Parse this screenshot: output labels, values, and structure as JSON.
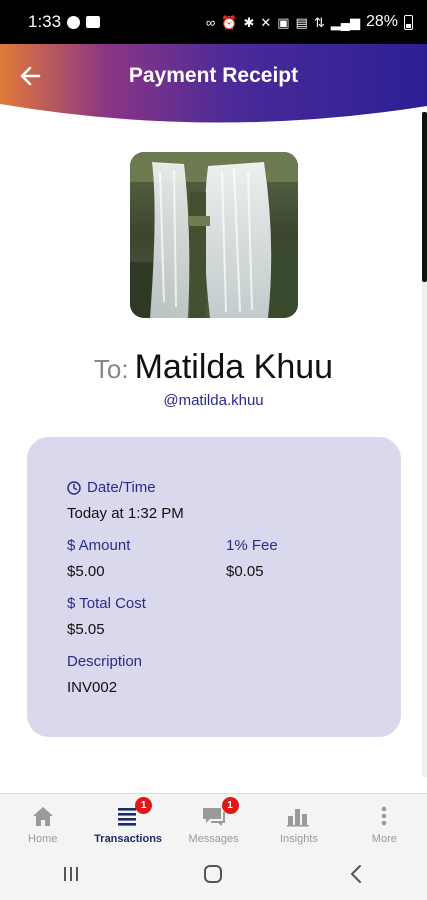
{
  "status_bar": {
    "time": "1:33",
    "battery": "28%"
  },
  "header": {
    "title": "Payment Receipt",
    "back_icon": "arrow-left-icon",
    "colors": {
      "start": "#e07a3a",
      "mid": "#7a2f8f",
      "end": "#2c1f96"
    }
  },
  "recipient": {
    "to_prefix": "To:",
    "name": "Matilda Khuu",
    "handle": "@matilda.khuu"
  },
  "details": {
    "datetime_label": "Date/Time",
    "datetime_value": "Today at 1:32 PM",
    "amount_label": "$ Amount",
    "amount_value": "$5.00",
    "fee_label": "1% Fee",
    "fee_value": "$0.05",
    "total_label": "$ Total Cost",
    "total_value": "$5.05",
    "description_label": "Description",
    "description_value": "INV002"
  },
  "bottom_nav": {
    "items": [
      {
        "label": "Home",
        "icon": "home-icon"
      },
      {
        "label": "Transactions",
        "icon": "list-icon",
        "badge": "1",
        "active": true
      },
      {
        "label": "Messages",
        "icon": "chat-icon",
        "badge": "1"
      },
      {
        "label": "Insights",
        "icon": "bar-chart-icon"
      },
      {
        "label": "More",
        "icon": "more-vertical-icon"
      }
    ]
  },
  "system_nav": {
    "recents_icon": "recents-icon",
    "home_icon": "home-circle-icon",
    "back_icon": "back-chevron-icon"
  }
}
